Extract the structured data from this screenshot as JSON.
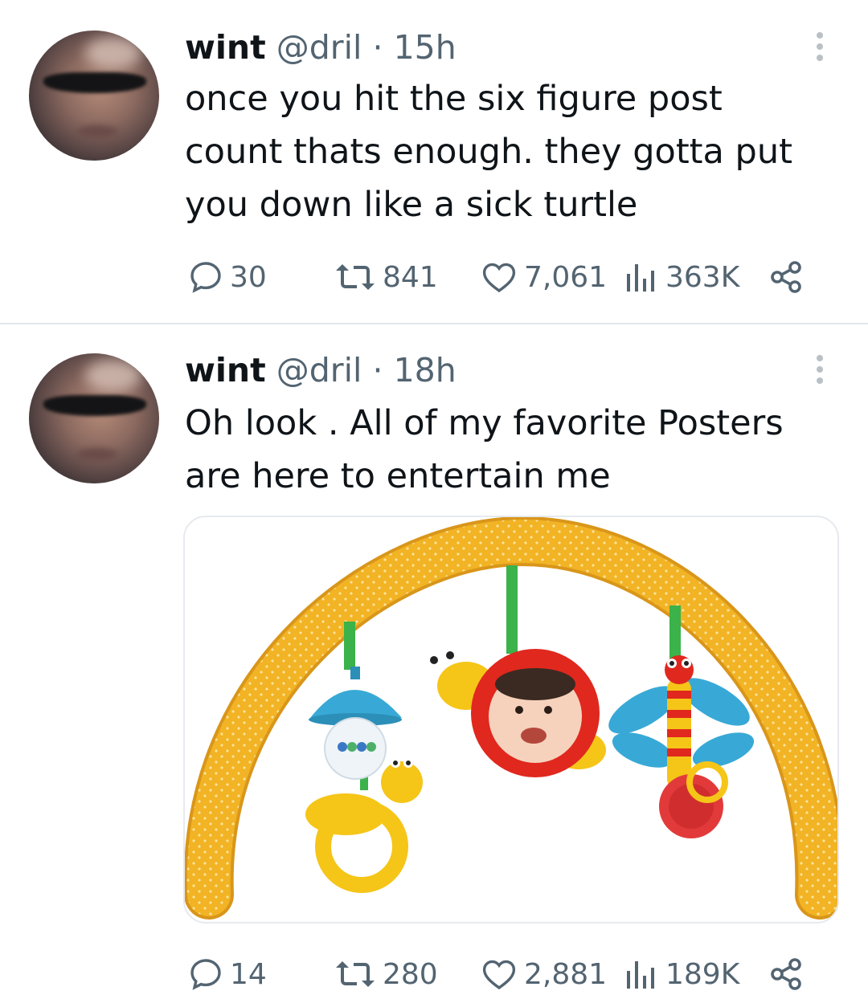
{
  "tweets": [
    {
      "author_name": "wint",
      "author_handle": "@dril",
      "separator": "·",
      "time": "15h",
      "text_lines": [
        "once you hit the six figure post",
        "count thats enough. they gotta put",
        "you down like a sick turtle"
      ],
      "replies": "30",
      "retweets": "841",
      "likes": "7,061",
      "views": "363K"
    },
    {
      "author_name": "wint",
      "author_handle": "@dril",
      "separator": "·",
      "time": "18h",
      "text_lines": [
        "Oh look . All of my favorite Posters",
        "are here to entertain me"
      ],
      "media_description_icon": "baby-toy-arch-image",
      "replies": "14",
      "retweets": "280",
      "likes": "2,881",
      "views": "189K"
    }
  ],
  "colors": {
    "text_primary": "#0f1419",
    "text_secondary": "#536471",
    "divider": "#e1e6ea"
  },
  "icons": {
    "reply": "reply-icon",
    "retweet": "retweet-icon",
    "like": "heart-icon",
    "views": "views-icon",
    "share": "share-icon",
    "more": "more-icon"
  }
}
